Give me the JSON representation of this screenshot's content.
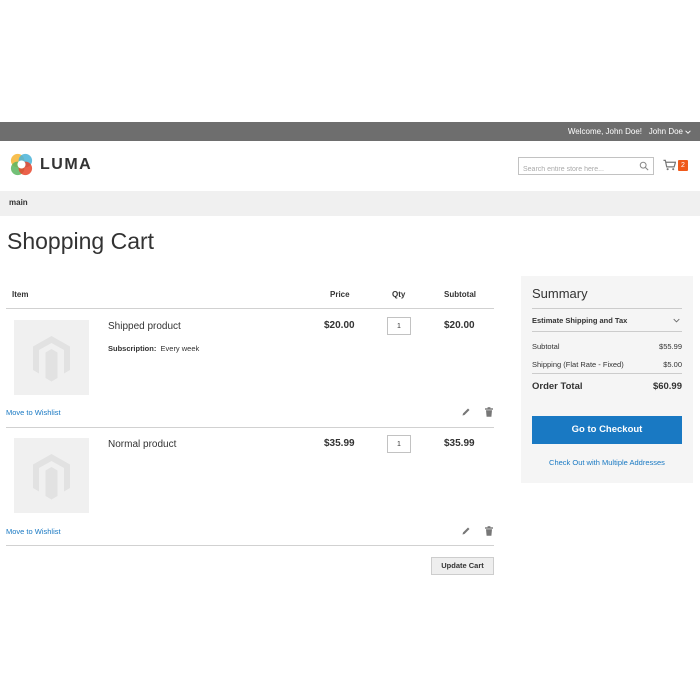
{
  "header": {
    "welcome": "Welcome, John Doe!",
    "user_name": "John Doe",
    "logo_text": "LUMA",
    "search_placeholder": "Search entire store here...",
    "cart_count": "2"
  },
  "nav": {
    "item": "main"
  },
  "page": {
    "title": "Shopping Cart"
  },
  "table": {
    "headers": {
      "item": "Item",
      "price": "Price",
      "qty": "Qty",
      "subtotal": "Subtotal"
    },
    "rows": [
      {
        "name": "Shipped product",
        "option_label": "Subscription:",
        "option_value": "Every week",
        "price": "$20.00",
        "qty": "1",
        "subtotal": "$20.00",
        "wishlist": "Move to Wishlist"
      },
      {
        "name": "Normal product",
        "price": "$35.99",
        "qty": "1",
        "subtotal": "$35.99",
        "wishlist": "Move to Wishlist"
      }
    ],
    "update_label": "Update Cart"
  },
  "summary": {
    "title": "Summary",
    "estimate": "Estimate Shipping and Tax",
    "subtotal_label": "Subtotal",
    "subtotal_value": "$55.99",
    "shipping_label": "Shipping (Flat Rate - Fixed)",
    "shipping_value": "$5.00",
    "total_label": "Order Total",
    "total_value": "$60.99",
    "checkout_label": "Go to Checkout",
    "multi_label": "Check Out with Multiple Addresses"
  },
  "colors": {
    "topbar": "#6e6e6e",
    "accent": "#1979c3",
    "cart_badge": "#ef5a1b"
  },
  "icons": [
    "chevron-down-icon",
    "luma-logo-icon",
    "search-icon",
    "cart-icon",
    "product-placeholder-icon",
    "edit-icon",
    "trash-icon"
  ]
}
